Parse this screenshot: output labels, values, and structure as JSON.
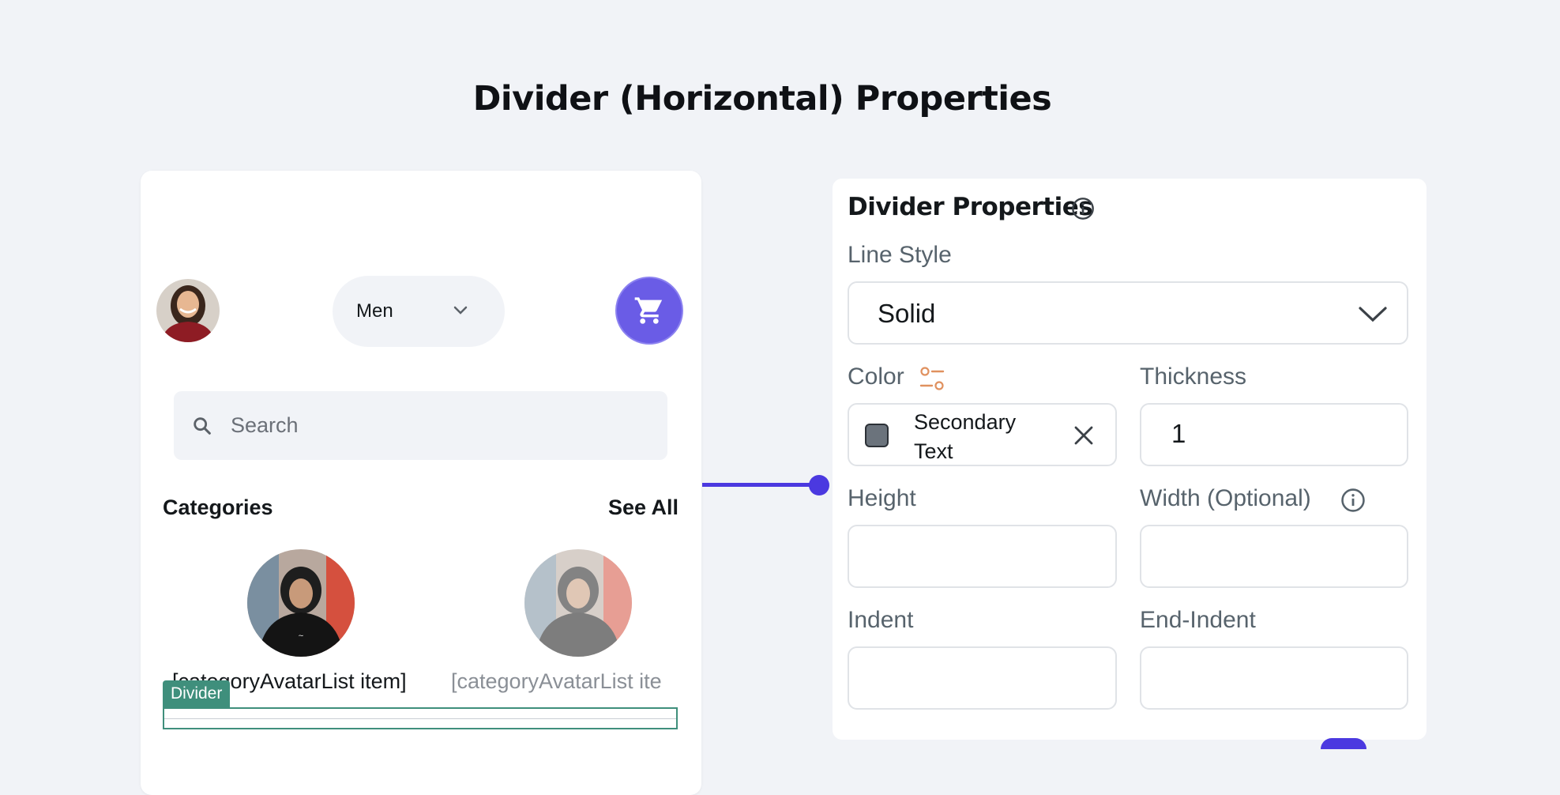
{
  "page": {
    "title": "Divider (Horizontal) Properties"
  },
  "phone": {
    "dropdown": {
      "value": "Men"
    },
    "search": {
      "placeholder": "Search"
    },
    "categories": {
      "title": "Categories",
      "see_all": "See All"
    },
    "category_items": [
      {
        "label": "[categoryAvatarList item]"
      },
      {
        "label": "[categoryAvatarList ite"
      }
    ],
    "selected_widget_tag": "Divider"
  },
  "panel": {
    "title": "Divider Properties",
    "line_style": {
      "label": "Line Style",
      "value": "Solid"
    },
    "color": {
      "label": "Color",
      "value": "Secondary Text",
      "swatch": "#6b737c"
    },
    "thickness": {
      "label": "Thickness",
      "value": "1"
    },
    "height": {
      "label": "Height",
      "value": ""
    },
    "width": {
      "label": "Width (Optional)",
      "value": ""
    },
    "indent": {
      "label": "Indent",
      "value": ""
    },
    "end_indent": {
      "label": "End-Indent",
      "value": ""
    }
  },
  "colors": {
    "accent": "#4b39e0",
    "cart_button": "#6a5ce6",
    "divider_highlight": "#3f8f7c",
    "background": "#f1f3f7"
  },
  "icons": {
    "cart": "shopping-cart-icon",
    "search": "search-icon",
    "dropdown": "chevron-down-icon",
    "info": "info-icon",
    "color_variables": "sliders-icon",
    "clear": "close-icon"
  }
}
